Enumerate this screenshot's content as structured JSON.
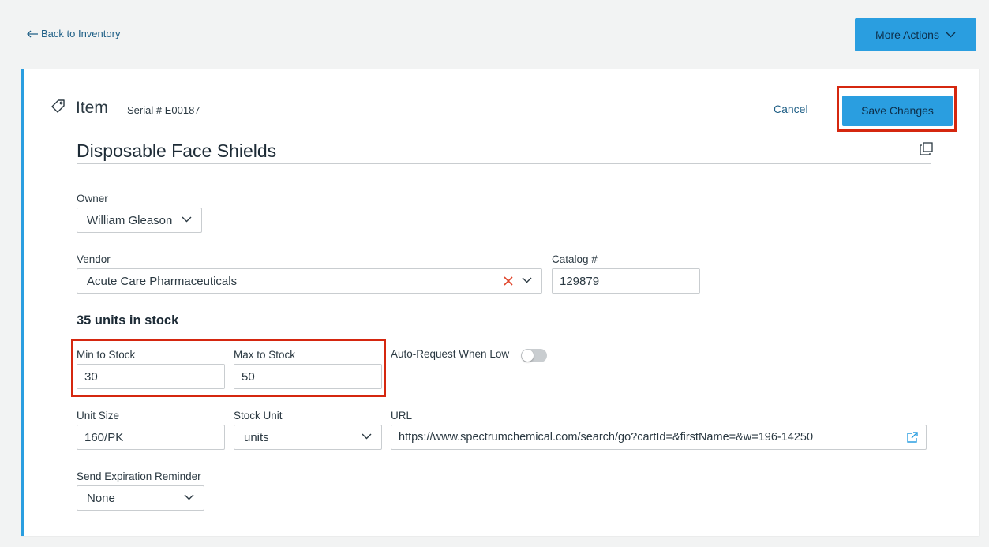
{
  "nav": {
    "back_label": "Back to Inventory",
    "more_actions_label": "More Actions"
  },
  "header": {
    "title": "Item",
    "serial_label": "Serial #",
    "serial_value": "E00187",
    "cancel_label": "Cancel",
    "save_label": "Save Changes"
  },
  "item": {
    "name": "Disposable Face Shields"
  },
  "owner": {
    "label": "Owner",
    "value": "William Gleason"
  },
  "vendor": {
    "label": "Vendor",
    "value": "Acute Care Pharmaceuticals"
  },
  "catalog": {
    "label": "Catalog #",
    "value": "129879"
  },
  "stock": {
    "text": "35 units in stock"
  },
  "min_stock": {
    "label": "Min to Stock",
    "value": "30"
  },
  "max_stock": {
    "label": "Max to Stock",
    "value": "50"
  },
  "auto_request": {
    "label": "Auto-Request When Low",
    "enabled": false
  },
  "unit_size": {
    "label": "Unit Size",
    "value": "160/PK"
  },
  "stock_unit": {
    "label": "Stock Unit",
    "value": "units"
  },
  "url": {
    "label": "URL",
    "value": "https://www.spectrumchemical.com/search/go?cartId=&firstName=&w=196-14250"
  },
  "expiration": {
    "label": "Send Expiration Reminder",
    "value": "None"
  },
  "colors": {
    "accent": "#2a9ee0",
    "highlight": "#d5270f",
    "link": "#1f5f86",
    "clear": "#e0442a"
  },
  "icons": [
    "arrow-left-icon",
    "chevron-down-icon",
    "tag-icon",
    "copy-icon",
    "clear-x-icon",
    "external-link-icon"
  ]
}
